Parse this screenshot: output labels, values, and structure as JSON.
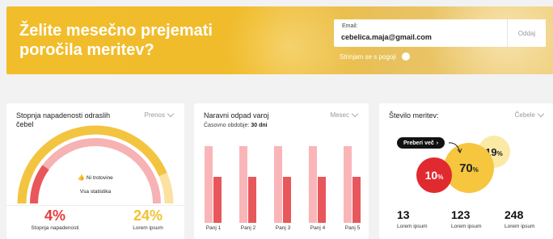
{
  "banner": {
    "title": "Želite mesečno prejemati poročila meritev?",
    "email_label": "Email:",
    "email_value": "cebelica.maja@gmail.com",
    "submit_label": "Oddaj",
    "consent_label": "Strinjam se s pogoji"
  },
  "infestation_card": {
    "title": "Stopnja napadenosti odraslih čebel",
    "filter": "Prenos",
    "gauge_caption": "Ni trotovine",
    "all_stats_link": "Vsa statistika",
    "stats": [
      {
        "value": "4",
        "unit": "%",
        "label": "Stopnja napadenosti",
        "color": "#e53c3c"
      },
      {
        "value": "24",
        "unit": "%",
        "label": "Lorem ipsum",
        "color": "#f1c232"
      }
    ],
    "gauge_levels": {
      "outer": 0.87,
      "inner": 0.2
    }
  },
  "natural_drop_card": {
    "title": "Naravni odpad varoj",
    "filter": "Mesec",
    "period_label": "Časovno obdobje:",
    "period_value": "30 dni",
    "chart_data": {
      "type": "bar",
      "categories": [
        "Panj 1",
        "Panj 2",
        "Panj 3",
        "Panj 4",
        "Panj 5"
      ],
      "series": [
        {
          "values": [
            95,
            95,
            95,
            95,
            95
          ],
          "color": "#f9b5b8"
        },
        {
          "values": [
            57,
            57,
            57,
            57,
            57
          ],
          "color": "#e8575b"
        }
      ],
      "ylim": [
        0,
        100
      ]
    }
  },
  "measurements_card": {
    "title": "Število meritev:",
    "filter": "Čebele",
    "more_button": "Preberi več",
    "bubbles": [
      {
        "value": "10",
        "unit": "%",
        "color": "#e02a2f"
      },
      {
        "value": "70",
        "unit": "%",
        "color": "#f6c63f"
      },
      {
        "value": "19",
        "unit": "%",
        "color": "#fbe9a6"
      }
    ],
    "counts": [
      {
        "value": "13",
        "label": "Lorem ipsum"
      },
      {
        "value": "123",
        "label": "Lorem ipsum"
      },
      {
        "value": "248",
        "label": "Lorem ipsum"
      }
    ]
  }
}
